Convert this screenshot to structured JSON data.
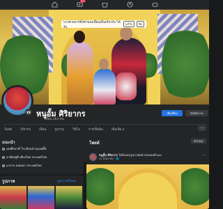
{
  "topbar": {
    "icons": [
      "home-icon",
      "video-icon",
      "marketplace-icon",
      "groups-icon",
      "gaming-icon"
    ],
    "video_badge": "9+"
  },
  "cover": {
    "notice_text": "บางส่วนการตั้งค่าของเพื่อนเห็นเกี่ยวกับ ได้รับ",
    "notice_button": "แก้ไข",
    "notice_button2": "ปิด"
  },
  "profile": {
    "name": "หนูอั้ม ศิริยากร",
    "friends": "เพื่อน 363 คน",
    "primary_button": "เพิ่มเพื่อน",
    "secondary_button": "ส่งข้อความ"
  },
  "tabs": {
    "items": [
      "โพสต์",
      "เกี่ยวกับ",
      "เพื่อน",
      "รูปภาพ",
      "วิดีโอ",
      "การเช็คอิน",
      "เพิ่มเติม ▾"
    ],
    "more": "..."
  },
  "intro": {
    "title": "แนะนำ",
    "items": [
      "เคยศึกษาที่ โรงเรียนบ้านดอยติ๊ด",
      "อาศัยอยู่ที่ เชียงใหม่ ประเทศไทย",
      "มาจาก ดอยเต่า ประเทศไทย"
    ]
  },
  "photos": {
    "title": "รูปภาพ",
    "link": "ดูรูปภาพทั้งหมด"
  },
  "posts": {
    "title": "โพสต์",
    "filter": "ตัวกรอง",
    "author": "หนูอั้ม ศิริยากร",
    "author_suffix": "ได้อัปเดตรูปภาพหน้าปกของตัวเอง",
    "meta": "21 มิถุนายน · 🌐",
    "more": "···"
  },
  "colors": {
    "background": "#18191a",
    "surface": "#242526",
    "accent": "#2374e1",
    "text": "#e4e6eb",
    "muted": "#b0b3b8"
  }
}
